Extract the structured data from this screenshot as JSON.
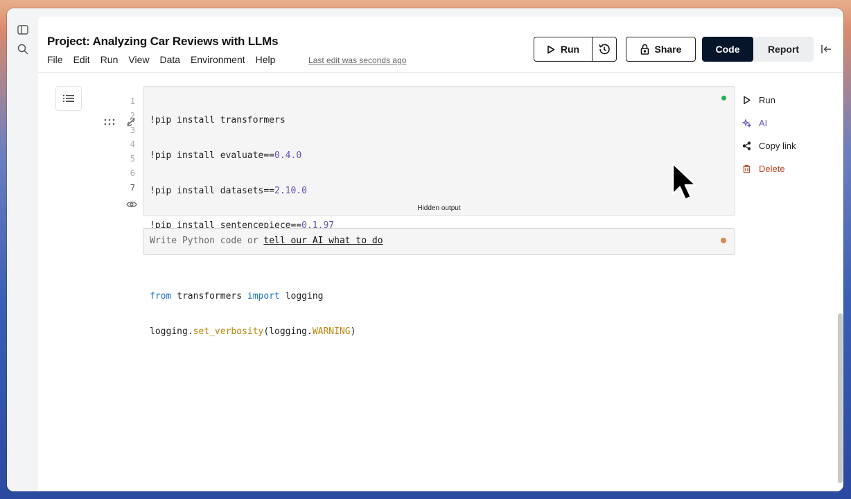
{
  "header": {
    "title": "Project: Analyzing Car Reviews with LLMs",
    "menu": [
      "File",
      "Edit",
      "Run",
      "View",
      "Data",
      "Environment",
      "Help"
    ],
    "last_edit": "Last edit was seconds ago"
  },
  "toolbar": {
    "run_label": "Run",
    "share_label": "Share",
    "code_label": "Code",
    "report_label": "Report"
  },
  "cell": {
    "line_numbers": [
      "1",
      "2",
      "3",
      "4",
      "5",
      "6",
      "7"
    ],
    "hidden_output_label": "Hidden output",
    "status_color": "#22b14c"
  },
  "prompt": {
    "text": "Write Python code or ",
    "link": "tell our AI what to do",
    "status_color": "#d9874a"
  },
  "side_actions": {
    "run": "Run",
    "ai": "AI",
    "copy_link": "Copy link",
    "delete": "Delete"
  },
  "code_lines": [
    "!pip install transformers",
    "!pip install evaluate==0.4.0",
    "!pip install datasets==2.10.0",
    "!pip install sentencepiece==0.1.97",
    "",
    "from transformers import logging",
    "logging.set_verbosity(logging.WARNING)"
  ],
  "code_tokens": {
    "l1": "!pip install transformers",
    "l2a": "!pip install evaluate==",
    "l2b": "0.4.0",
    "l3a": "!pip install datasets==",
    "l3b": "2.10.0",
    "l4a": "!pip install sentencepiece==",
    "l4b": "0.1.97",
    "l6a": "from",
    "l6b": " transformers ",
    "l6c": "import",
    "l6d": " logging",
    "l7a": "logging.",
    "l7b": "set_verbosity",
    "l7c": "(logging.",
    "l7d": "WARNING",
    "l7e": ")"
  },
  "colors": {
    "primary_dark": "#06152a",
    "keyword_blue": "#1f6fd1",
    "function_gold": "#b8860b",
    "ai_purple": "#6553c8",
    "delete_red": "#b34a2b"
  }
}
